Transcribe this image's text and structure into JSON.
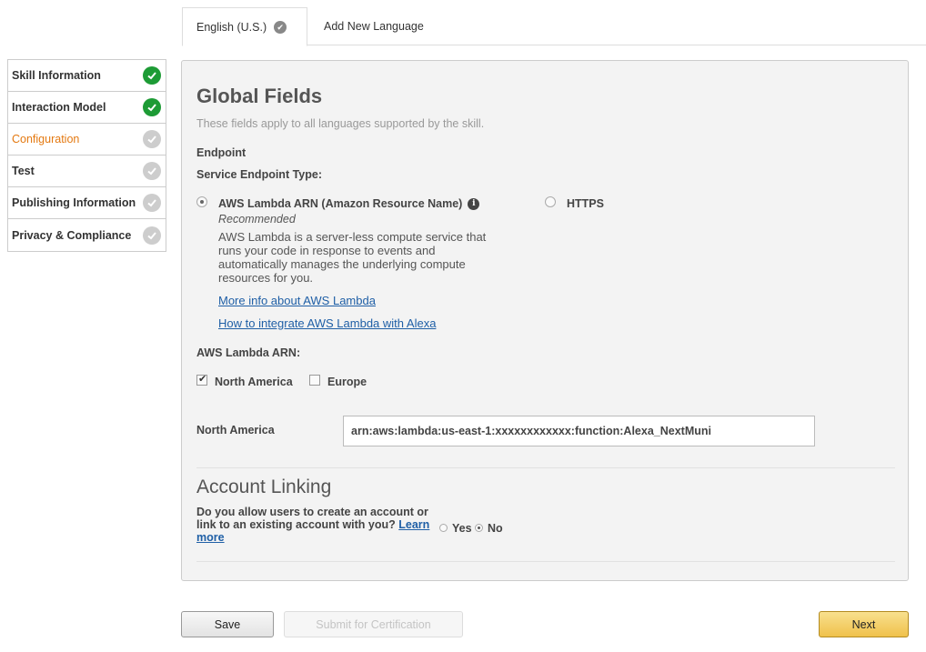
{
  "tabs": [
    {
      "label": "English (U.S.)",
      "active": true,
      "icon": "check-circle-icon"
    },
    {
      "label": "Add New Language",
      "active": false
    }
  ],
  "sidebar": {
    "items": [
      {
        "label": "Skill Information",
        "status": "complete"
      },
      {
        "label": "Interaction Model",
        "status": "complete"
      },
      {
        "label": "Configuration",
        "status": "incomplete",
        "active": true
      },
      {
        "label": "Test",
        "status": "incomplete"
      },
      {
        "label": "Publishing Information",
        "status": "incomplete"
      },
      {
        "label": "Privacy & Compliance",
        "status": "incomplete"
      }
    ]
  },
  "global_fields": {
    "title": "Global Fields",
    "description": "These fields apply to all languages supported by the skill.",
    "endpoint_label": "Endpoint",
    "service_endpoint_type_label": "Service Endpoint Type:",
    "lambda_option": {
      "label": "AWS Lambda ARN (Amazon Resource Name)",
      "selected": true,
      "recommended": "Recommended",
      "description": "AWS Lambda is a server-less compute service that runs your code in response to events and automatically manages the underlying compute resources for you.",
      "link_more_info": "More info about AWS Lambda",
      "link_integrate": "How to integrate AWS Lambda with Alexa"
    },
    "https_option": {
      "label": "HTTPS",
      "selected": false
    },
    "lambda_arn_label": "AWS Lambda ARN:",
    "regions": [
      {
        "label": "North America",
        "checked": true
      },
      {
        "label": "Europe",
        "checked": false
      }
    ],
    "north_america_field": {
      "label": "North America",
      "value": "arn:aws:lambda:us-east-1:xxxxxxxxxxxx:function:Alexa_NextMuni"
    }
  },
  "account_linking": {
    "title": "Account Linking",
    "question": "Do you allow users to create an account or link to an existing account with you?",
    "learn_more": "Learn more",
    "options": [
      {
        "label": "Yes",
        "selected": false
      },
      {
        "label": "No",
        "selected": true
      }
    ]
  },
  "buttons": {
    "save": "Save",
    "submit": "Submit for Certification",
    "next": "Next"
  },
  "colors": {
    "complete": "#1d9b35",
    "incomplete": "#cdcdcd",
    "active_nav": "#e47911",
    "link": "#1f5fa6",
    "next_button": "#f0c14b"
  }
}
